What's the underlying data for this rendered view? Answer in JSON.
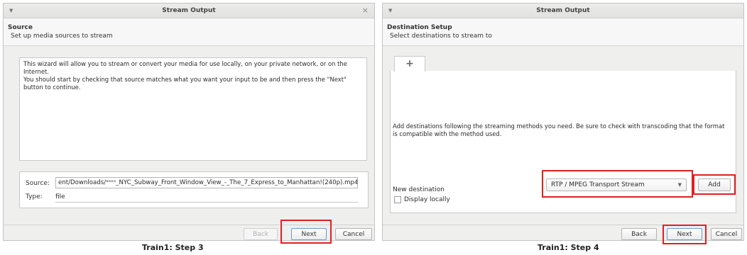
{
  "left": {
    "title": "Stream Output",
    "header_title": "Source",
    "header_sub": "Set up media sources to stream",
    "wizard_line1": "This wizard will allow you to stream or convert your media for use locally, on your private network, or on the Internet.",
    "wizard_line2": "You should start by checking that source matches what you want your input to be and then press the \"Next\" button to continue.",
    "source_label": "Source:",
    "source_value": "ent/Downloads/ᵃᵉᵒᵒ_NYC_Subway_Front_Window_View_-_The_7_Express_to_Manhattan!(240p).mp4",
    "type_label": "Type:",
    "type_value": "file",
    "back": "Back",
    "next": "Next",
    "cancel": "Cancel",
    "caption": "Train1: Step 3"
  },
  "right": {
    "title": "Stream Output",
    "header_title": "Destination Setup",
    "header_sub": "Select destinations to stream to",
    "tab_symbol": "+",
    "dest_text": "Add destinations following the streaming methods you need. Be sure to check with transcoding that the format is compatible with the method used.",
    "new_dest_label": "New destination",
    "combo_value": "RTP / MPEG Transport Stream",
    "add": "Add",
    "display_locally": "Display locally",
    "back": "Back",
    "next": "Next",
    "cancel": "Cancel",
    "caption": "Train1: Step 4"
  },
  "colors": {
    "highlight": "#e02020",
    "window_bg": "#efefee"
  },
  "icons": {
    "menu": "chevron-down-icon",
    "close": "close-icon",
    "combo": "chevron-down-icon"
  }
}
